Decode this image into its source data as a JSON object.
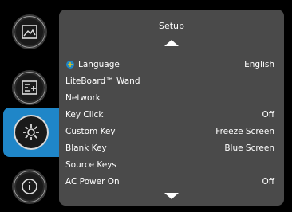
{
  "sidebar": {
    "tabs": [
      {
        "name": "picture",
        "icon": "picture-icon"
      },
      {
        "name": "settings",
        "icon": "settings-icon"
      },
      {
        "name": "setup",
        "icon": "gear-icon",
        "active": true
      },
      {
        "name": "status",
        "icon": "info-icon"
      }
    ]
  },
  "panel": {
    "title": "Setup",
    "items": [
      {
        "label": "Language",
        "value": "English"
      },
      {
        "label": "LiteBoard™ Wand",
        "value": ""
      },
      {
        "label": "Network",
        "value": ""
      },
      {
        "label": "Key Click",
        "value": "Off"
      },
      {
        "label": "Custom Key",
        "value": "Freeze Screen"
      },
      {
        "label": "Blank Key",
        "value": "Blue Screen"
      },
      {
        "label": "Source Keys",
        "value": ""
      },
      {
        "label": "AC Power On",
        "value": "Off"
      }
    ]
  },
  "colors": {
    "accent": "#1f86c8",
    "panel": "#4a4a4a"
  }
}
